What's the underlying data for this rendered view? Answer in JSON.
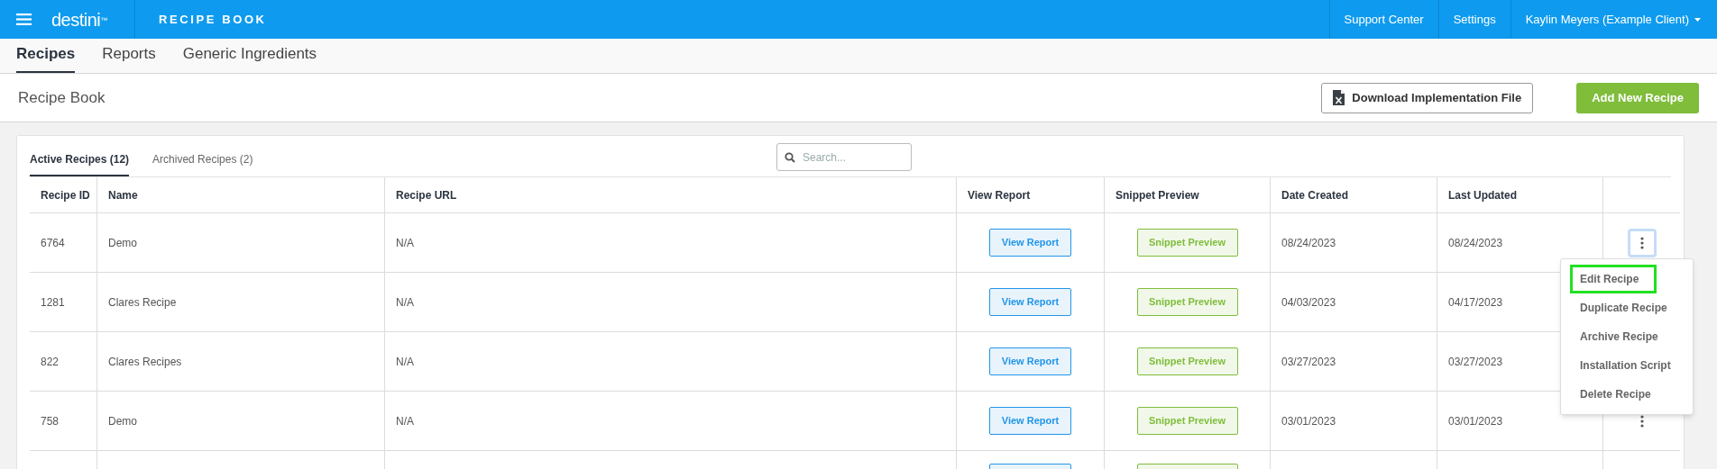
{
  "top_bar": {
    "logo": "destini$^{™}$",
    "title": "RECIPE BOOK",
    "links": [
      "Support Center",
      "Settings"
    ],
    "user": "Kaylin Meyers (Example Client)"
  },
  "nav_tabs": [
    {
      "label": "Recipes",
      "selected": true
    },
    {
      "label": "Reports",
      "selected": false
    },
    {
      "label": "Generic Ingredients",
      "selected": false
    }
  ],
  "header": {
    "title": "Recipe Book",
    "buttons": [
      {
        "kind": "outline",
        "label": "Download Implementation File"
      },
      {
        "kind": "primary",
        "label": "Add New Recipe"
      }
    ]
  },
  "list_tabs": [
    {
      "label": "Active Recipes (12)",
      "selected": true
    },
    {
      "label": "Archived Recipes (2)",
      "selected": false
    }
  ],
  "search": {
    "placeholder": "Search..."
  },
  "table": {
    "columns": [
      "Recipe ID",
      "Name",
      "Recipe URL",
      "View Report",
      "Snippet Preview",
      "Date Created",
      "Last Updated"
    ],
    "rows": [
      {
        "id": "6764",
        "name": "Demo",
        "url": "N/A",
        "view_report": "View Report",
        "snippet_preview": "Snippet Preview",
        "date_created": "08/24/2023",
        "last_updated": "08/24/2023",
        "menu_button": {
          "focused": true
        }
      },
      {
        "id": "1281",
        "name": "Clares Recipe",
        "url": "N/A",
        "view_report": "View Report",
        "snippet_preview": "Snippet Preview",
        "date_created": "04/03/2023",
        "last_updated": "04/17/2023"
      },
      {
        "id": "822",
        "name": "Clares Recipes",
        "url": "N/A",
        "view_report": "View Report",
        "snippet_preview": "Snippet Preview",
        "date_created": "03/27/2023",
        "last_updated": "03/27/2023"
      },
      {
        "id": "758",
        "name": "Demo",
        "url": "N/A",
        "view_report": "View Report",
        "snippet_preview": "Snippet Preview",
        "date_created": "03/01/2023",
        "last_updated": "03/01/2023",
        "menu_button": {
          "focused": false
        }
      }
    ]
  },
  "row_menu": [
    {
      "label": "Edit Recipe",
      "selected": true
    },
    {
      "label": "Duplicate Recipe",
      "selected": false
    },
    {
      "label": "Archive Recipe",
      "selected": false
    },
    {
      "label": "Installation Script",
      "selected": false
    },
    {
      "label": "Delete Recipe",
      "selected": false
    }
  ]
}
